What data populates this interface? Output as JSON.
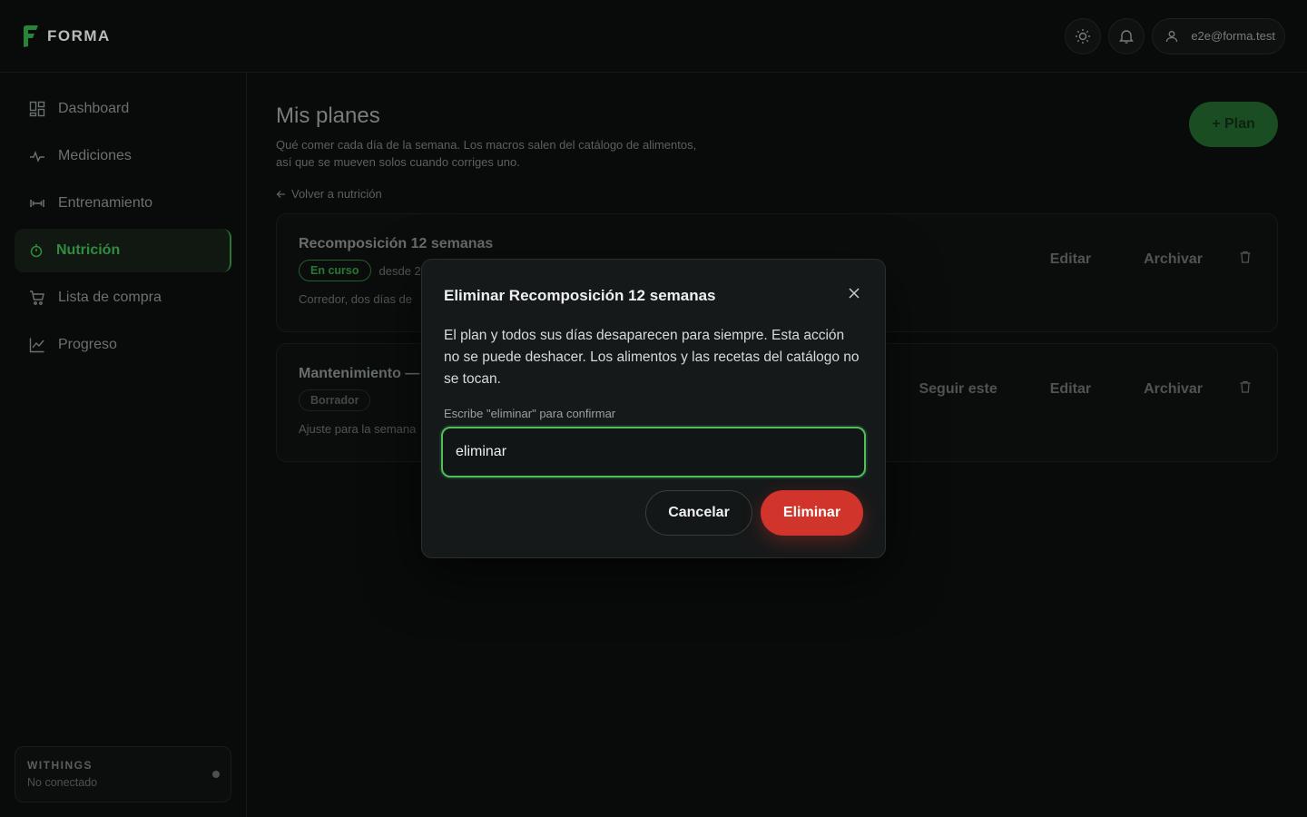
{
  "app": {
    "brand": "FORMA"
  },
  "header": {
    "user_email": "e2e@forma.test"
  },
  "sidebar": {
    "items": [
      {
        "label": "Dashboard",
        "icon": "dashboard-icon"
      },
      {
        "label": "Mediciones",
        "icon": "activity-icon"
      },
      {
        "label": "Entrenamiento",
        "icon": "dumbbell-icon"
      },
      {
        "label": "Nutrición",
        "icon": "nutrition-icon",
        "active": true
      },
      {
        "label": "Lista de compra",
        "icon": "cart-icon"
      },
      {
        "label": "Progreso",
        "icon": "chart-icon"
      }
    ],
    "integration": {
      "title": "WITHINGS",
      "status": "No conectado"
    }
  },
  "main": {
    "title": "Mis planes",
    "description_line1": "Qué comer cada día de la semana. Los macros salen del catálogo de alimentos,",
    "description_line2": "así que se mueven solos cuando corriges uno.",
    "back_link": "Volver a nutrición",
    "add_plan_label": "+ Plan",
    "plans": [
      {
        "title": "Recomposición 12 semanas",
        "badge": "En curso",
        "since": "desde 2",
        "description": "Corredor, dos días de",
        "actions": [
          "Editar",
          "Archivar"
        ]
      },
      {
        "title": "Mantenimiento —",
        "badge": "Borrador",
        "description": "Ajuste para la semana",
        "actions": [
          "Seguir este",
          "Editar",
          "Archivar"
        ]
      }
    ]
  },
  "modal": {
    "title": "Eliminar Recomposición 12 semanas",
    "body": "El plan y todos sus días desaparecen para siempre. Esta acción no se puede deshacer. Los alimentos y las recetas del catálogo no se tocan.",
    "input_label": "Escribe \"eliminar\" para confirmar",
    "input_value": "eliminar",
    "cancel_label": "Cancelar",
    "delete_label": "Eliminar"
  },
  "colors": {
    "accent": "#39a64a",
    "danger": "#d1342a",
    "focus": "#4fbf5e"
  }
}
